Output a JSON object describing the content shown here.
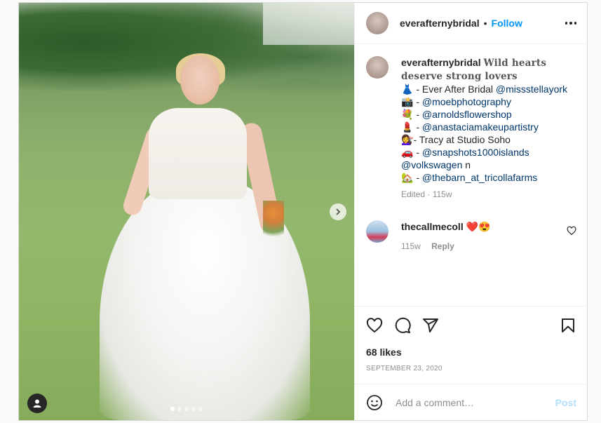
{
  "photo": {
    "dot_count": 5,
    "active_dot": 0
  },
  "header": {
    "username": "everafternybridal",
    "separator": "•",
    "follow_label": "Follow"
  },
  "caption": {
    "username": "everafternybridal",
    "title": "Wild hearts deserve strong lovers",
    "lines": [
      {
        "emoji": "👗",
        "text": " - Ever After Bridal ",
        "mention": "@missstellayork"
      },
      {
        "emoji": "📸",
        "text": " - ",
        "mention": "@moebphotography"
      },
      {
        "emoji": "💐",
        "text": " - ",
        "mention": "@arnoldsflowershop"
      },
      {
        "emoji": "💄",
        "text": " - ",
        "mention": "@anastaciamakeupartistry"
      },
      {
        "emoji": "💇‍♀️",
        "text": "- Tracy at Studio Soho",
        "mention": ""
      },
      {
        "emoji": "🚗",
        "text": " - ",
        "mention": "@snapshots1000islands"
      },
      {
        "emoji": "",
        "text": "",
        "mention": "@volkswagen",
        "suffix": " n"
      },
      {
        "emoji": "🏡",
        "text": " - ",
        "mention": "@thebarn_at_tricollafarms"
      }
    ],
    "meta": "Edited · 115w"
  },
  "comment": {
    "username": "thecallmecoll",
    "text": " ❤️😍",
    "age": "115w",
    "reply_label": "Reply"
  },
  "likes": "68 likes",
  "date": "SEPTEMBER 23, 2020",
  "add_comment": {
    "placeholder": "Add a comment…",
    "post_label": "Post"
  },
  "colors": {
    "accent": "#0095f6",
    "mention": "#00376b",
    "muted": "#8e8e8e",
    "post_disabled": "#b2dffc"
  }
}
